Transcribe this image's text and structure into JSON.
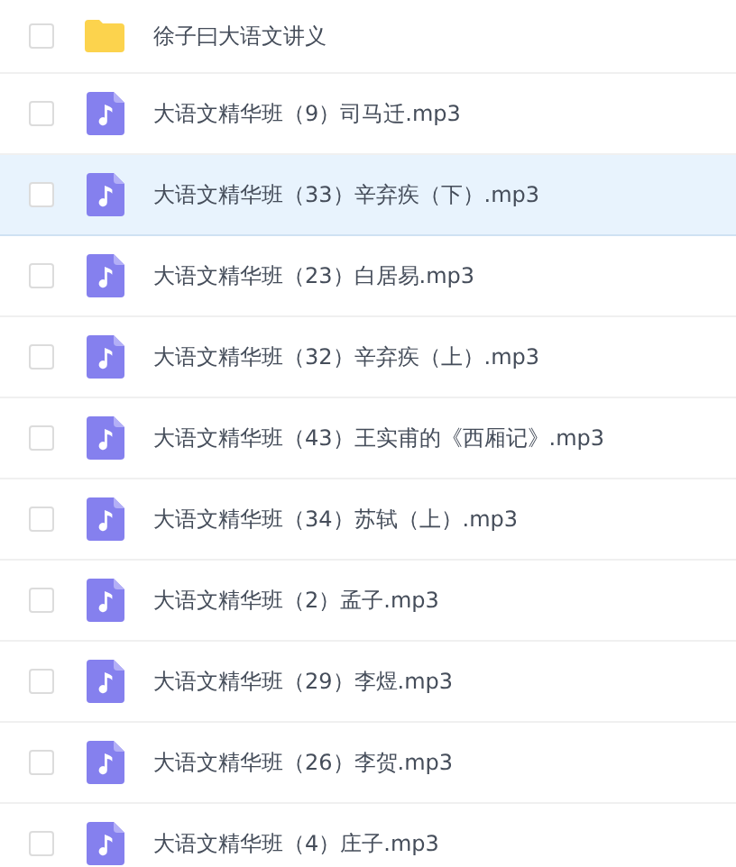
{
  "files": [
    {
      "kind": "folder",
      "name": "徐子曰大语文讲义",
      "checked": false,
      "highlighted": false
    },
    {
      "kind": "audio",
      "name": "大语文精华班（9）司马迁.mp3",
      "checked": false,
      "highlighted": false
    },
    {
      "kind": "audio",
      "name": "大语文精华班（33）辛弃疾（下）.mp3",
      "checked": false,
      "highlighted": true
    },
    {
      "kind": "audio",
      "name": "大语文精华班（23）白居易.mp3",
      "checked": false,
      "highlighted": false
    },
    {
      "kind": "audio",
      "name": "大语文精华班（32）辛弃疾（上）.mp3",
      "checked": false,
      "highlighted": false
    },
    {
      "kind": "audio",
      "name": "大语文精华班（43）王实甫的《西厢记》.mp3",
      "checked": false,
      "highlighted": false
    },
    {
      "kind": "audio",
      "name": "大语文精华班（34）苏轼（上）.mp3",
      "checked": false,
      "highlighted": false
    },
    {
      "kind": "audio",
      "name": "大语文精华班（2）孟子.mp3",
      "checked": false,
      "highlighted": false
    },
    {
      "kind": "audio",
      "name": "大语文精华班（29）李煜.mp3",
      "checked": false,
      "highlighted": false
    },
    {
      "kind": "audio",
      "name": "大语文精华班（26）李贺.mp3",
      "checked": false,
      "highlighted": false
    },
    {
      "kind": "audio",
      "name": "大语文精华班（4）庄子.mp3",
      "checked": false,
      "highlighted": false
    }
  ]
}
